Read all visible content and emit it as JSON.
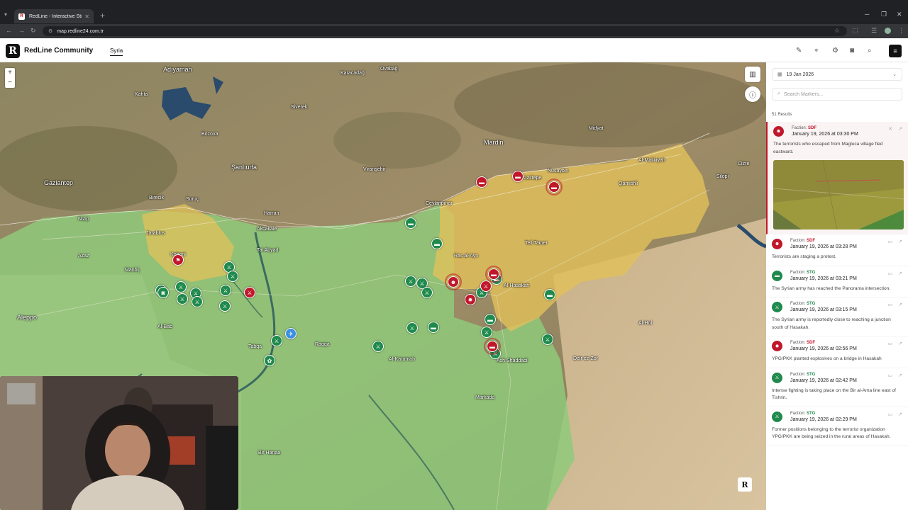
{
  "browser": {
    "tab_title": "RedLine - Interactive Strategic M",
    "tab_close": "✕",
    "url": "map.redline24.com.tr"
  },
  "app": {
    "logo": "R",
    "brand": "RedLine Community",
    "region_tab": "Syria"
  },
  "map": {
    "zoom_in": "+",
    "zoom_out": "−",
    "places": [
      {
        "name": "Adıyaman",
        "big": true
      },
      {
        "name": "Gaziantep",
        "big": true
      },
      {
        "name": "Şanlıurfa",
        "big": true
      },
      {
        "name": "Mardin",
        "big": true
      },
      {
        "name": "Aleppo",
        "big": true
      },
      {
        "name": "Karacadağ"
      },
      {
        "name": "Ovabağ"
      },
      {
        "name": "Kızıltepe"
      },
      {
        "name": "Viranşehir"
      },
      {
        "name": "Akçakale"
      },
      {
        "name": "Ceylanpınar"
      },
      {
        "name": "Nusaybin"
      },
      {
        "name": "Cizre"
      },
      {
        "name": "Harran"
      },
      {
        "name": "Suruç"
      },
      {
        "name": "Siverek"
      },
      {
        "name": "Kobani"
      },
      {
        "name": "Manbij"
      },
      {
        "name": "Tal Abyad"
      },
      {
        "name": "Ras al-Ayn"
      },
      {
        "name": "Tell Tamer"
      },
      {
        "name": "Al-Hasakah"
      },
      {
        "name": "Qamishli"
      },
      {
        "name": "Al-Malikiyah"
      },
      {
        "name": "Raqqa"
      },
      {
        "name": "Al-Bab"
      },
      {
        "name": "Ash Shaddadi"
      },
      {
        "name": "Deir ez-Zor"
      },
      {
        "name": "Tabqa"
      },
      {
        "name": "Al-Karamah"
      },
      {
        "name": "Jarablus"
      },
      {
        "name": "Azaz"
      },
      {
        "name": "Nizip"
      },
      {
        "name": "Birecik"
      },
      {
        "name": "Bozova"
      },
      {
        "name": "Kahta"
      },
      {
        "name": "Midyat"
      },
      {
        "name": "Silopi"
      },
      {
        "name": "Bir Hanaa"
      },
      {
        "name": "Al-Hol"
      },
      {
        "name": "Markada"
      }
    ],
    "r_badge": "R"
  },
  "panel": {
    "date_value": "19 Jan 2026",
    "search_placeholder": "Search Markers...",
    "results": "51 Results",
    "items": [
      {
        "faction_prefix": "Faction: ",
        "faction": "SDF",
        "date": "January 19, 2026 at 03:30 PM",
        "text": "The terrorists who escaped from Magluca village fled eastward."
      },
      {
        "faction_prefix": "Faction: ",
        "faction": "SDF",
        "date": "January 19, 2026 at 03:28 PM",
        "text": "Terrorists are staging a protest."
      },
      {
        "faction_prefix": "Faction: ",
        "faction": "STG",
        "date": "January 19, 2026 at 03:21 PM",
        "text": "The Syrian army has reached the Panorama intersection."
      },
      {
        "faction_prefix": "Faction: ",
        "faction": "STG",
        "date": "January 19, 2026 at 03:15 PM",
        "text": "The Syrian army is reportedly close to reaching a junction south of Hasakah."
      },
      {
        "faction_prefix": "Faction: ",
        "faction": "SDF",
        "date": "January 19, 2026 at 02:56 PM",
        "text": "YPG/PKK planted explosives on a bridge in Hasakah"
      },
      {
        "faction_prefix": "Faction: ",
        "faction": "STG",
        "date": "January 19, 2026 at 02:42 PM",
        "text": "Intense fighting is taking place on the Bir al-Ama line east of Tishrin."
      },
      {
        "faction_prefix": "Faction: ",
        "faction": "STG",
        "date": "January 19, 2026 at 02:29 PM",
        "text": "Former positions belonging to the terrorist organization YPG/PKK are being seized in the rural areas of Hasakah."
      }
    ]
  },
  "colors": {
    "stg": "#1f8a4c",
    "sdf": "#c0182b",
    "stg_zone": "#8fc97a",
    "sdf_zone": "#e2c15a",
    "turkey_land": "#9a8a64"
  },
  "icons": {
    "draw": "pencil-icon",
    "pin": "pin-icon",
    "settings": "gear-icon",
    "camera": "camera-icon",
    "search": "search-icon",
    "menu": "hamburger-icon",
    "map_layers": "map-icon",
    "info": "info-icon"
  }
}
